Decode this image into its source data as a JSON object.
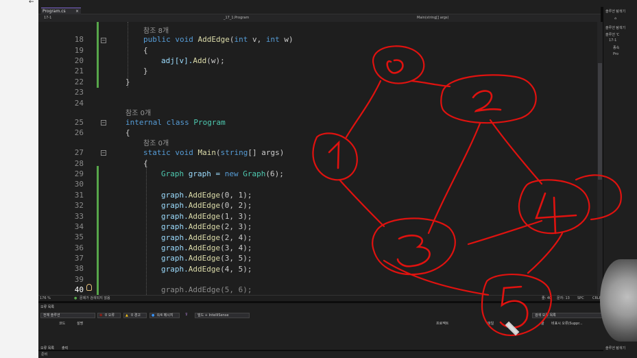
{
  "app": {
    "back_icon": "back-arrow-icon"
  },
  "tab": {
    "label": "Program.cs",
    "close": "×"
  },
  "nav": {
    "project": "17-1",
    "namespace": "_17_1.Program",
    "member": "Main(string[] args)"
  },
  "code_lines": [
    {
      "ln": "18"
    },
    {
      "ln": "19"
    },
    {
      "ln": "20"
    },
    {
      "ln": "21"
    },
    {
      "ln": "22"
    },
    {
      "ln": "23"
    },
    {
      "ln": "24"
    },
    {
      "ln": "25"
    },
    {
      "ln": "26"
    },
    {
      "ln": "27"
    },
    {
      "ln": "28"
    },
    {
      "ln": "29"
    },
    {
      "ln": "30"
    },
    {
      "ln": "31"
    },
    {
      "ln": "32"
    },
    {
      "ln": "33"
    },
    {
      "ln": "34"
    },
    {
      "ln": "35"
    },
    {
      "ln": "36"
    },
    {
      "ln": "37"
    },
    {
      "ln": "38"
    },
    {
      "ln": "39"
    },
    {
      "ln": "40"
    }
  ],
  "refs": {
    "r1": "참조 8개",
    "r2": "참조 0개",
    "r3": "참조 0개"
  },
  "code": {
    "l18_kw": "public void ",
    "l18_fn": "AddEdge",
    "l18_p1": "(",
    "l18_t1": "int",
    "l18_v": " v, ",
    "l18_t2": "int",
    "l18_w": " w)",
    "l19": "{",
    "l20_a": "adj[v].",
    "l20_fn": "Add",
    "l20_b": "(w);",
    "l21": "}",
    "l22": "}",
    "l25_kw": "internal class ",
    "l25_ty": "Program",
    "l26": "{",
    "l27_kw": "static void ",
    "l27_fn": "Main",
    "l27_p": "(",
    "l27_t": "string",
    "l27_r": "[] args)",
    "l28": "{",
    "l29_ty": "Graph",
    "l29_a": " graph = ",
    "l29_kw": "new ",
    "l29_ty2": "Graph",
    "l29_b": "(6);",
    "edges": [
      "(0, 1);",
      "(0, 2);",
      "(1, 3);",
      "(2, 3);",
      "(2, 4);",
      "(3, 4);",
      "(3, 5);",
      "(4, 5);"
    ],
    "edge_prefix": "graph.",
    "edge_fn": "AddEdge",
    "l40": "graph.AddEdge(5, 6);"
  },
  "status": {
    "zoom": "176 %",
    "issues": "문제가 검색되지 않음",
    "line": "줄: 40",
    "char": "문자: 13",
    "mode": "SPC",
    "eol": "CRLF"
  },
  "errors": {
    "title": "오류 목록",
    "scope": "전체 솔루션",
    "errors": "0 오류",
    "warnings": "0 경고",
    "messages": "0/4 메시지",
    "build": "빌드 + IntelliSense",
    "search": "검색 오류 목록",
    "col_code": "코드",
    "col_desc": "설명",
    "col_project": "프로젝트",
    "col_file": "파일",
    "col_line": "줄",
    "col_suppress": "비표시 오류(Suppr...",
    "tab_errors": "오류 목록",
    "tab_output": "출력"
  },
  "solution": {
    "title": "솔루션 탐색기",
    "sol": "솔루션 'C",
    "proj": "17-1",
    "dep": "종속",
    "file": "Pro",
    "bottom": "솔루션 탐색기",
    "bottom2": "준비"
  },
  "drawing": {
    "nodes": [
      "0",
      "1",
      "2",
      "3",
      "4",
      "5"
    ]
  }
}
